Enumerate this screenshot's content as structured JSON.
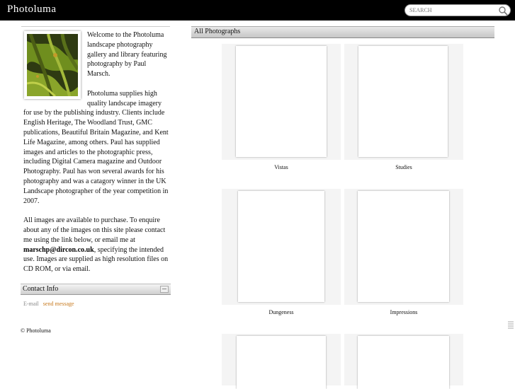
{
  "header": {
    "brand": "Photoluma",
    "search_placeholder": "SEARCH"
  },
  "sidebar": {
    "paragraphs": [
      "Welcome to the Photoluma landscape photography gallery and library featuring photography by Paul Marsch.",
      "Photoluma supplies high quality landscape imagery for use by the publishing industry. Clients include English Heritage, The Woodland Trust, GMC publications, Beautiful Britain Magazine, and Kent Life Magazine, among others. Paul has supplied images and articles to the photographic press, including Digital Camera magazine and Outdoor Photography. Paul has won several awards for his photography and was a catagory winner in the UK Landscape photographer of the year competition in 2007."
    ],
    "purchase_before": "All images are available to purchase. To enquire about any of the images on this site please contact me using the link below, or email me at ",
    "email": "marschp@dircon.co.uk",
    "purchase_after": ", specifying the intended use. Images are supplied as high resolution files on CD ROM, or via email.",
    "contact_title": "Contact Info",
    "contact_label": "E-mail",
    "contact_link": "send message",
    "copyright": "© Photoluma"
  },
  "gallery": {
    "title": "All Photographs",
    "albums": [
      {
        "name": "Vistas"
      },
      {
        "name": "Studies"
      },
      {
        "name": "Dungeness"
      },
      {
        "name": "Impressions"
      },
      {
        "name": ""
      },
      {
        "name": ""
      }
    ]
  }
}
